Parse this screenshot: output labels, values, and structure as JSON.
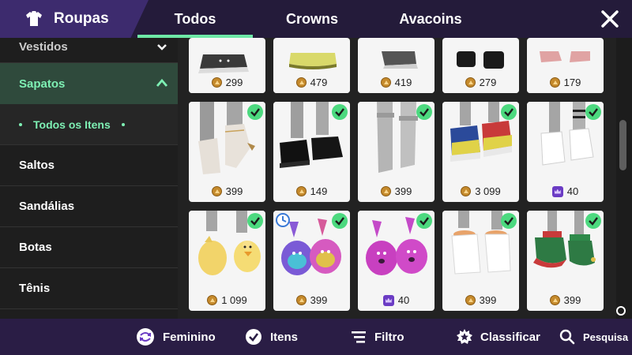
{
  "header": {
    "title": "Roupas",
    "tabs": [
      {
        "label": "Todos",
        "active": true
      },
      {
        "label": "Crowns",
        "active": false
      },
      {
        "label": "Avacoins",
        "active": false
      }
    ],
    "close_icon": "close-icon"
  },
  "sidebar": {
    "items": [
      {
        "label": "Vestidos",
        "state": "collapsed"
      },
      {
        "label": "Sapatos",
        "state": "expanded"
      },
      {
        "label": "Todos os Itens",
        "state": "sub-selected"
      },
      {
        "label": "Saltos"
      },
      {
        "label": "Sandálias"
      },
      {
        "label": "Botas"
      },
      {
        "label": "Tênis"
      }
    ]
  },
  "grid": {
    "top_row": [
      {
        "price": "299",
        "currency": "avacoins"
      },
      {
        "price": "479",
        "currency": "avacoins"
      },
      {
        "price": "419",
        "currency": "avacoins"
      },
      {
        "price": "279",
        "currency": "avacoins"
      },
      {
        "price": "179",
        "currency": "avacoins"
      }
    ],
    "row_2": [
      {
        "price": "399",
        "currency": "avacoins",
        "owned": true,
        "item": "white fur heel boots"
      },
      {
        "price": "149",
        "currency": "avacoins",
        "owned": true,
        "item": "black shoes"
      },
      {
        "price": "399",
        "currency": "avacoins",
        "owned": true,
        "item": "grey knee boots"
      },
      {
        "price": "3 099",
        "currency": "avacoins",
        "owned": true,
        "item": "colorful sneakers"
      },
      {
        "price": "40",
        "currency": "crowns",
        "owned": true,
        "item": "white boots"
      }
    ],
    "row_3": [
      {
        "price": "1 099",
        "currency": "avacoins",
        "owned": true,
        "item": "duck slippers"
      },
      {
        "price": "399",
        "currency": "avacoins",
        "owned": true,
        "limited": true,
        "item": "tie-dye bunny slippers"
      },
      {
        "price": "40",
        "currency": "crowns",
        "owned": true,
        "item": "pink bunny slippers"
      },
      {
        "price": "399",
        "currency": "avacoins",
        "owned": true,
        "item": "white fluffy slippers"
      },
      {
        "price": "399",
        "currency": "avacoins",
        "owned": true,
        "item": "elf shoes"
      }
    ]
  },
  "bottom_bar": {
    "gender": {
      "label": "Feminino",
      "icon": "gender-swap-icon"
    },
    "items": {
      "label": "Itens",
      "icon": "check-circle-icon"
    },
    "filter": {
      "label": "Filtro",
      "icon": "filter-icon"
    },
    "sort": {
      "label": "Classificar",
      "icon": "star-badge-icon"
    },
    "search": {
      "label": "Pesquisa",
      "icon": "search-icon"
    }
  },
  "colors": {
    "accent": "#6ee8a7",
    "header_bg": "#241b3a",
    "brand_bg": "#3d2b6e",
    "bottom_bg": "#2a1d45",
    "owned_check": "#4cd97f"
  }
}
